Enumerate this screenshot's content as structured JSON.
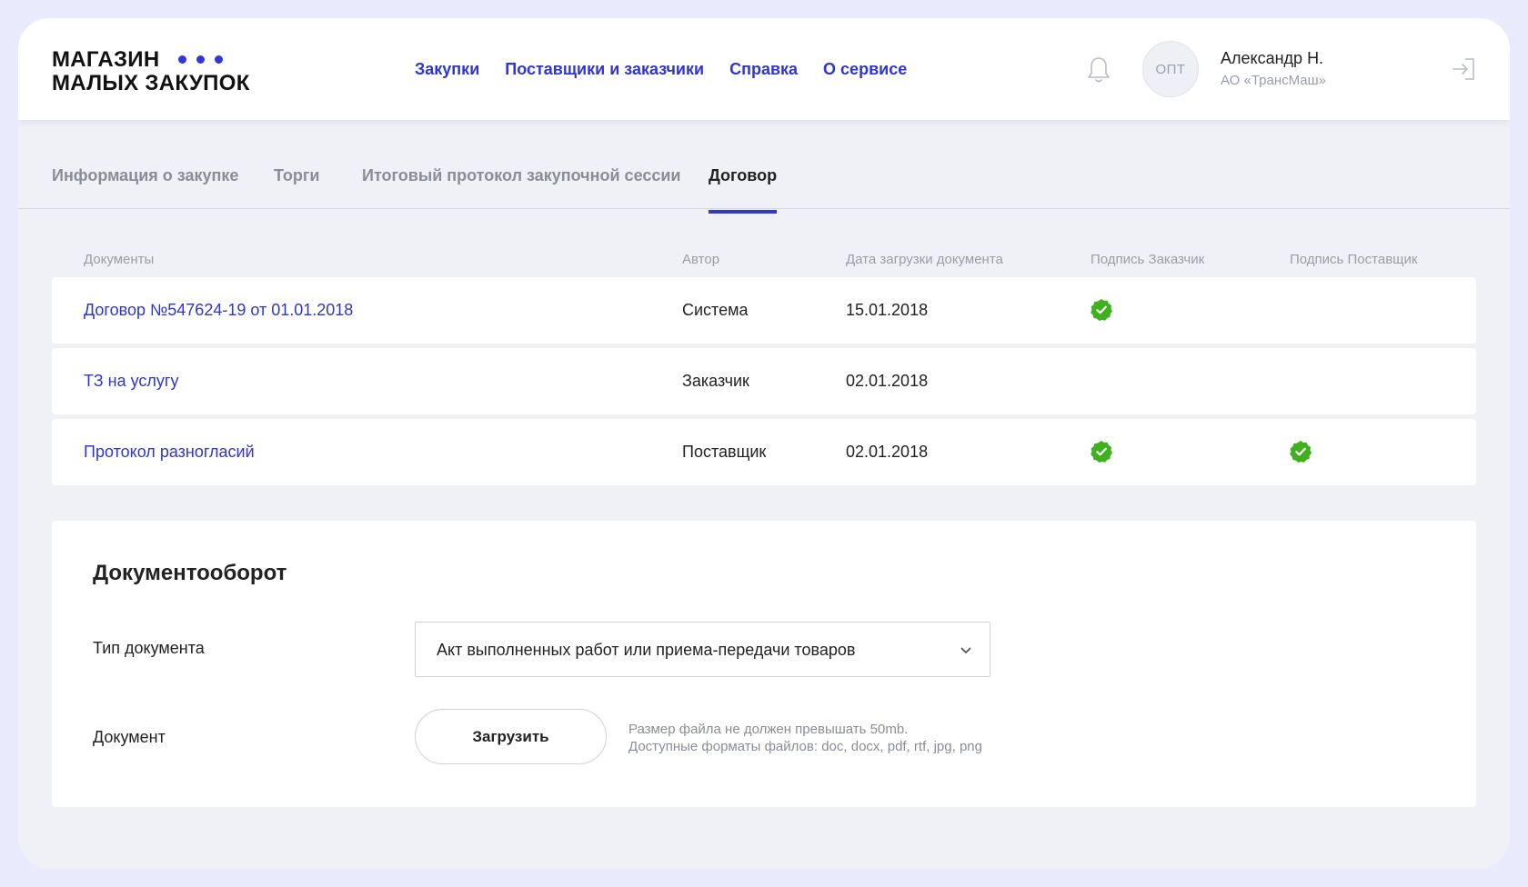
{
  "header": {
    "logo_line1": "МАГАЗИН",
    "logo_line2": "МАЛЫХ ЗАКУПОК",
    "nav": [
      "Закупки",
      "Поставщики и заказчики",
      "Справка",
      "О сервисе"
    ],
    "avatar_text": "ОПТ",
    "user_name": "Александр Н.",
    "user_org": "АО «ТрансМаш»",
    "icons": {
      "notifications": "bell-icon",
      "logout": "logout-icon"
    }
  },
  "tabs": [
    {
      "label": "Информация о закупке",
      "active": false
    },
    {
      "label": "Торги",
      "active": false
    },
    {
      "label": "Итоговый протокол закупочной сессии",
      "active": false
    },
    {
      "label": "Договор",
      "active": true
    }
  ],
  "documents_table": {
    "columns": [
      "Документы",
      "Автор",
      "Дата загрузки документа",
      "Подпись Заказчик",
      "Подпись Поставщик"
    ],
    "rows": [
      {
        "document": "Договор №547624-19 от 01.01.2018",
        "author": "Система",
        "date": "15.01.2018",
        "signed_customer": true,
        "signed_supplier": false
      },
      {
        "document": "ТЗ на услугу",
        "author": "Заказчик",
        "date": "02.01.2018",
        "signed_customer": false,
        "signed_supplier": false
      },
      {
        "document": "Протокол разногласий",
        "author": "Поставщик",
        "date": "02.01.2018",
        "signed_customer": true,
        "signed_supplier": true
      }
    ]
  },
  "docflow": {
    "title": "Документооборот",
    "doc_type_label": "Тип документа",
    "doc_type_value": "Акт выполненных работ или приема-передачи товаров",
    "document_label": "Документ",
    "upload_label": "Загрузить",
    "hint_size": "Размер файла не должен превышать 50mb.",
    "hint_formats": "Доступные форматы файлов: doc, docx, pdf, rtf, jpg, png"
  },
  "colors": {
    "accent": "#3236d4",
    "link": "#2f35d0",
    "check": "#3fb01e",
    "background": "#f0f1f6",
    "outer": "#e9eafb"
  }
}
